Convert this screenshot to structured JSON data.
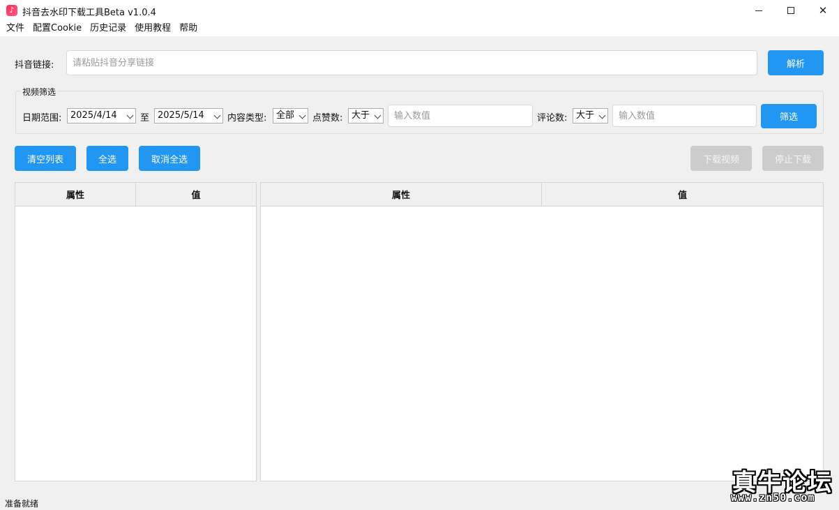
{
  "window": {
    "title": "抖音去水印下载工具Beta v1.0.4"
  },
  "menu": [
    "文件",
    "配置Cookie",
    "历史记录",
    "使用教程",
    "帮助"
  ],
  "link": {
    "label": "抖音链接:",
    "placeholder": "请粘贴抖音分享链接",
    "parse_label": "解析"
  },
  "filter": {
    "group_title": "视频筛选",
    "date_label": "日期范围:",
    "date_from": "2025/4/14",
    "to_label": "至",
    "date_to": "2025/5/14",
    "type_label": "内容类型:",
    "type_value": "全部",
    "likes_label": "点赞数:",
    "likes_op": "大于",
    "likes_placeholder": "输入数值",
    "comments_label": "评论数:",
    "comments_op": "大于",
    "comments_placeholder": "输入数值",
    "filter_label": "筛选"
  },
  "actions": {
    "clear_list": "清空列表",
    "select_all": "全选",
    "deselect_all": "取消全选",
    "download": "下载视频",
    "stop": "停止下载"
  },
  "tables": {
    "left_headers": [
      "属性",
      "值"
    ],
    "right_headers": [
      "属性",
      "值"
    ]
  },
  "status": "准备就绪",
  "watermark": {
    "title": "真牛论坛",
    "url": "www.zn50.com"
  },
  "colors": {
    "primary": "#2196f3",
    "disabled": "#cccccc"
  }
}
